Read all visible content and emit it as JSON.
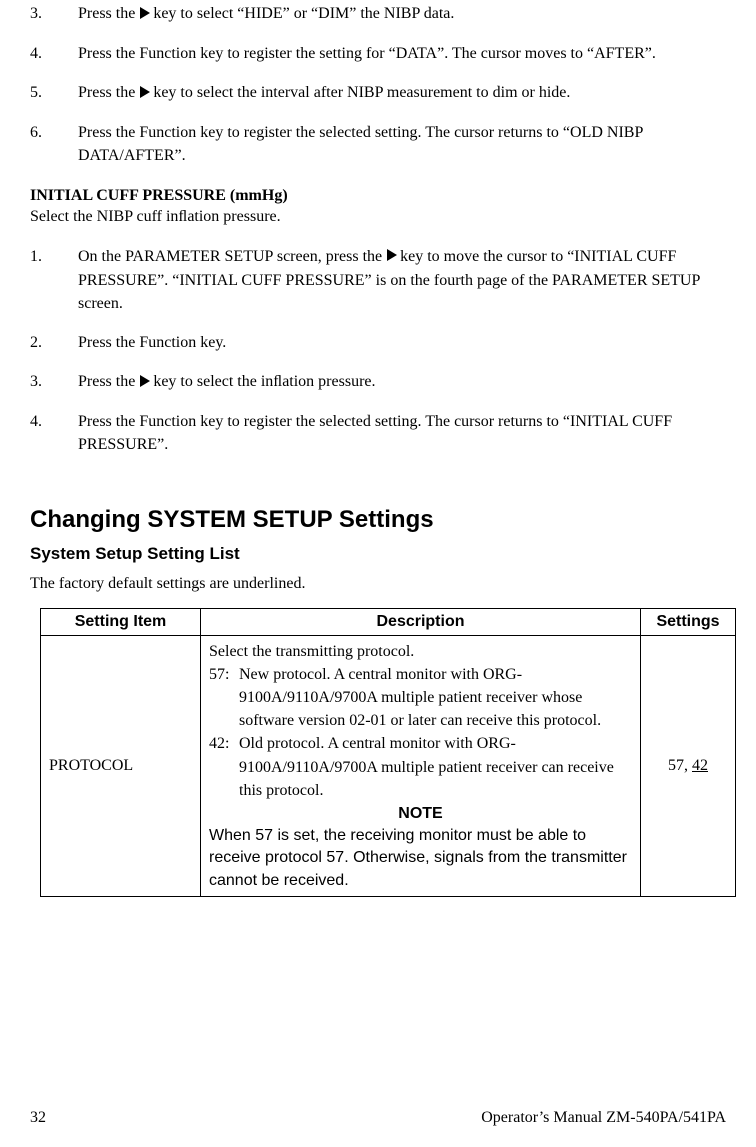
{
  "steps_a": [
    {
      "num": "3.",
      "pre": "Press the ",
      "icon": true,
      "post": "key to select “HIDE” or “DIM” the NIBP data."
    },
    {
      "num": "4.",
      "text": "Press the Function key to register the setting for “DATA”. The cursor moves to “AFTER”."
    },
    {
      "num": "5.",
      "pre": "Press the ",
      "icon": true,
      "post": "key to select the interval after NIBP measurement to dim or hide."
    },
    {
      "num": "6.",
      "text": "Press the Function key to register the selected setting. The cursor returns to “OLD NIBP DATA/AFTER”."
    }
  ],
  "section_b_head": "INITIAL CUFF PRESSURE (mmHg)",
  "section_b_sub": "Select the NIBP cuff inﬂation pressure.",
  "steps_b": [
    {
      "num": "1.",
      "pre": "On the PARAMETER SETUP screen, press the ",
      "icon": true,
      "post": "key to move the cursor to “INITIAL CUFF PRESSURE”. “INITIAL CUFF PRESSURE” is on the fourth page of the PARAMETER SETUP screen."
    },
    {
      "num": "2.",
      "text": "Press the Function key."
    },
    {
      "num": "3.",
      "pre": "Press the ",
      "icon": true,
      "post": "key to select the inﬂation pressure."
    },
    {
      "num": "4.",
      "text": "Press the Function key to register the selected setting. The cursor returns to “INITIAL CUFF PRESSURE”."
    }
  ],
  "h_system": "Changing SYSTEM SETUP Settings",
  "h_sub": "System Setup Setting List",
  "factory_note": "The factory default settings are underlined.",
  "table": {
    "headers": {
      "item": "Setting Item",
      "desc": "Description",
      "settings": "Settings"
    },
    "row1": {
      "item": "PROTOCOL",
      "desc_intro": "Select the transmitting protocol.",
      "opt1_key": "57:",
      "opt1_val": "New protocol. A central monitor with ORG-9100A/9110A/9700A multiple patient receiver whose software version 02-01 or later can receive this protocol.",
      "opt2_key": "42:",
      "opt2_val": "Old protocol. A central monitor with ORG-9100A/9110A/9700A multiple patient receiver can receive this protocol.",
      "note_head": "NOTE",
      "note_body": "When 57 is set, the receiving monitor must be able to receive protocol 57. Otherwise, signals from the transmitter cannot be received.",
      "setting_a": "57, ",
      "setting_default": "42"
    }
  },
  "footer": {
    "page": "32",
    "manual": "Operator’s Manual  ZM-540PA/541PA"
  }
}
